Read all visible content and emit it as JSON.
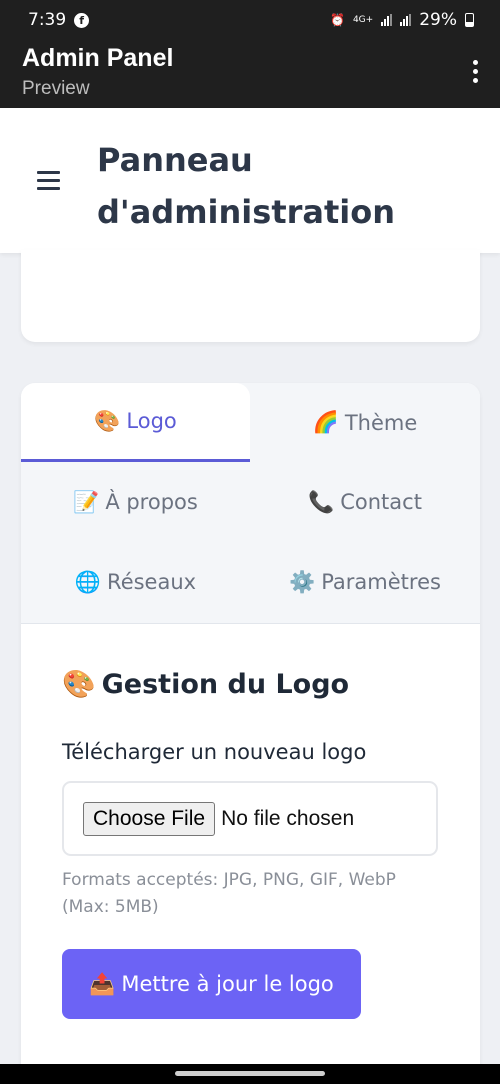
{
  "status_bar": {
    "time": "7:39",
    "network": "4G+",
    "battery": "29%",
    "icons": [
      "facebook-icon",
      "alarm-icon",
      "signal-icon",
      "battery-icon"
    ]
  },
  "app_bar": {
    "title": "Admin Panel",
    "subtitle": "Preview",
    "menu_icon": "more-vert-icon"
  },
  "header": {
    "title": "Panneau d'administration",
    "menu_icon": "hamburger-icon"
  },
  "tabs": [
    {
      "emoji": "🎨",
      "label": "Logo",
      "active": true
    },
    {
      "emoji": "🌈",
      "label": "Thème",
      "active": false
    },
    {
      "emoji": "📝",
      "label": "À propos",
      "active": false
    },
    {
      "emoji": "📞",
      "label": "Contact",
      "active": false
    },
    {
      "emoji": "🌐",
      "label": "Réseaux",
      "active": false
    },
    {
      "emoji": "⚙️",
      "label": "Paramètres",
      "active": false
    }
  ],
  "logo_section": {
    "emoji": "🎨",
    "title": "Gestion du Logo",
    "upload_label": "Télécharger un nouveau logo",
    "choose_button": "Choose File",
    "file_status": "No file chosen",
    "help": "Formats acceptés: JPG, PNG, GIF, WebP (Max: 5MB)",
    "submit_emoji": "📤",
    "submit_label": "Mettre à jour le logo"
  },
  "colors": {
    "accent": "#6c63f5",
    "active_tab": "#5b5bd6",
    "dark_bar": "#1f1f1f",
    "heading": "#2d3748"
  }
}
